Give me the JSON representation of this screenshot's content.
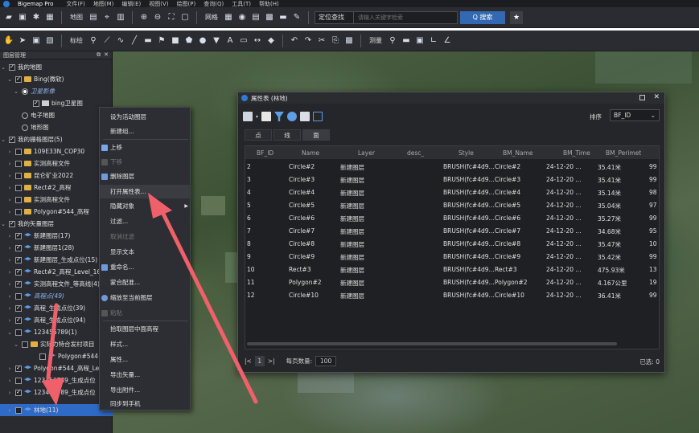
{
  "app": {
    "title": "Bigemap Pro",
    "menu": [
      "文件(F)",
      "地图(M)",
      "编辑(E)",
      "视图(V)",
      "绘图(P)",
      "查询(Q)",
      "工具(T)",
      "帮助(H)"
    ]
  },
  "toolbar1": {
    "map_label": "地图",
    "grid_label": "网格",
    "search": {
      "mode": "定位查找",
      "placeholder": "请输入关键字检索",
      "button": "Q 搜索"
    }
  },
  "toolbar2": {
    "mark_label": "标绘",
    "measure_label": "测量"
  },
  "layer_panel": {
    "title": "图层管理",
    "items": [
      {
        "label": "我的地图"
      },
      {
        "label": "Bing(微软)"
      },
      {
        "label": "卫星影像"
      },
      {
        "label": "bing卫星图"
      },
      {
        "label": "电子地图"
      },
      {
        "label": "地形图"
      },
      {
        "label": "我的栅格图层(5)"
      },
      {
        "label": "109E33N_COP30"
      },
      {
        "label": "实测高程文件"
      },
      {
        "label": "昆仑矿业2022"
      },
      {
        "label": "Rect#2_高程"
      },
      {
        "label": "实测高程文件"
      },
      {
        "label": "Polygon#544_高程"
      },
      {
        "label": "我的矢量图层"
      },
      {
        "label": "新建图层(17)"
      },
      {
        "label": "新建图层1(28)"
      },
      {
        "label": "新建图层_生成点位(15)"
      },
      {
        "label": "Rect#2_高程_Level_16"
      },
      {
        "label": "实测高程文件_等高线(4)"
      },
      {
        "label": "高程点(49)"
      },
      {
        "label": "高程_生成点位(39)"
      },
      {
        "label": "高程_生成点位(94)"
      },
      {
        "label": "123456789(1)"
      },
      {
        "label": "实际力特合发村项目"
      },
      {
        "label": "Polygon#544"
      },
      {
        "label": "Polygon#544_高程_Level"
      },
      {
        "label": "123456789_生成点位"
      },
      {
        "label": "123456789_生成点位"
      },
      {
        "label": "林地(11)"
      }
    ]
  },
  "context_menu": {
    "items": [
      "设为活动图层",
      "新建组...",
      "上移",
      "下移",
      "删除图层",
      "打开属性表...",
      "隐藏对象",
      "过滤...",
      "取消过滤",
      "显示文本",
      "重命名...",
      "蒙合配准...",
      "缩放至当前图层",
      "粘贴",
      "拾取图层中面高程",
      "样式...",
      "属性...",
      "导出矢量...",
      "导出附件...",
      "同步到手机"
    ]
  },
  "attr_window": {
    "title": "属性表 (林地)",
    "sort_label": "排序",
    "sort_value": "BF_ID",
    "tabs": [
      "点",
      "线",
      "面"
    ],
    "columns": [
      "BF_ID",
      "Name",
      "Layer",
      "desc_",
      "Style",
      "BM_Name",
      "BM_Time",
      "BM_Perimet",
      ""
    ],
    "rows": [
      [
        "2",
        "Circle#2",
        "新建图层",
        "",
        "BRUSH(fc#4d9...",
        "Circle#2",
        "24-12-20 ...",
        "35.41米",
        "99"
      ],
      [
        "3",
        "Circle#3",
        "新建图层",
        "",
        "BRUSH(fc#4d9...",
        "Circle#3",
        "24-12-20 ...",
        "35.41米",
        "99"
      ],
      [
        "4",
        "Circle#4",
        "新建图层",
        "",
        "BRUSH(fc#4d9...",
        "Circle#4",
        "24-12-20 ...",
        "35.14米",
        "98"
      ],
      [
        "5",
        "Circle#5",
        "新建图层",
        "",
        "BRUSH(fc#4d9...",
        "Circle#5",
        "24-12-20 ...",
        "35.04米",
        "97"
      ],
      [
        "6",
        "Circle#6",
        "新建图层",
        "",
        "BRUSH(fc#4d9...",
        "Circle#6",
        "24-12-20 ...",
        "35.27米",
        "99"
      ],
      [
        "7",
        "Circle#7",
        "新建图层",
        "",
        "BRUSH(fc#4d9...",
        "Circle#7",
        "24-12-20 ...",
        "34.68米",
        "95"
      ],
      [
        "8",
        "Circle#8",
        "新建图层",
        "",
        "BRUSH(fc#4d9...",
        "Circle#8",
        "24-12-20 ...",
        "35.47米",
        "10"
      ],
      [
        "9",
        "Circle#9",
        "新建图层",
        "",
        "BRUSH(fc#4d9...",
        "Circle#9",
        "24-12-20 ...",
        "35.42米",
        "99"
      ],
      [
        "10",
        "Rect#3",
        "新建图层",
        "",
        "BRUSH(fc#4d9...",
        "Rect#3",
        "24-12-20 ...",
        "475.93米",
        "13"
      ],
      [
        "11",
        "Polygon#2",
        "新建图层",
        "",
        "BRUSH(fc#4d9...",
        "Polygon#2",
        "24-12-20 ...",
        "4.167公里",
        "19"
      ],
      [
        "12",
        "Circle#10",
        "新建图层",
        "",
        "BRUSH(fc#4d9...",
        "Circle#10",
        "24-12-20 ...",
        "36.41米",
        "99"
      ]
    ],
    "pager": {
      "page": "1",
      "size_label": "每页数量:",
      "size": "100",
      "selected": "已选: 0"
    }
  },
  "colors": {
    "accent": "#2f6ac6",
    "annotation_arrow": "#f0606a"
  }
}
